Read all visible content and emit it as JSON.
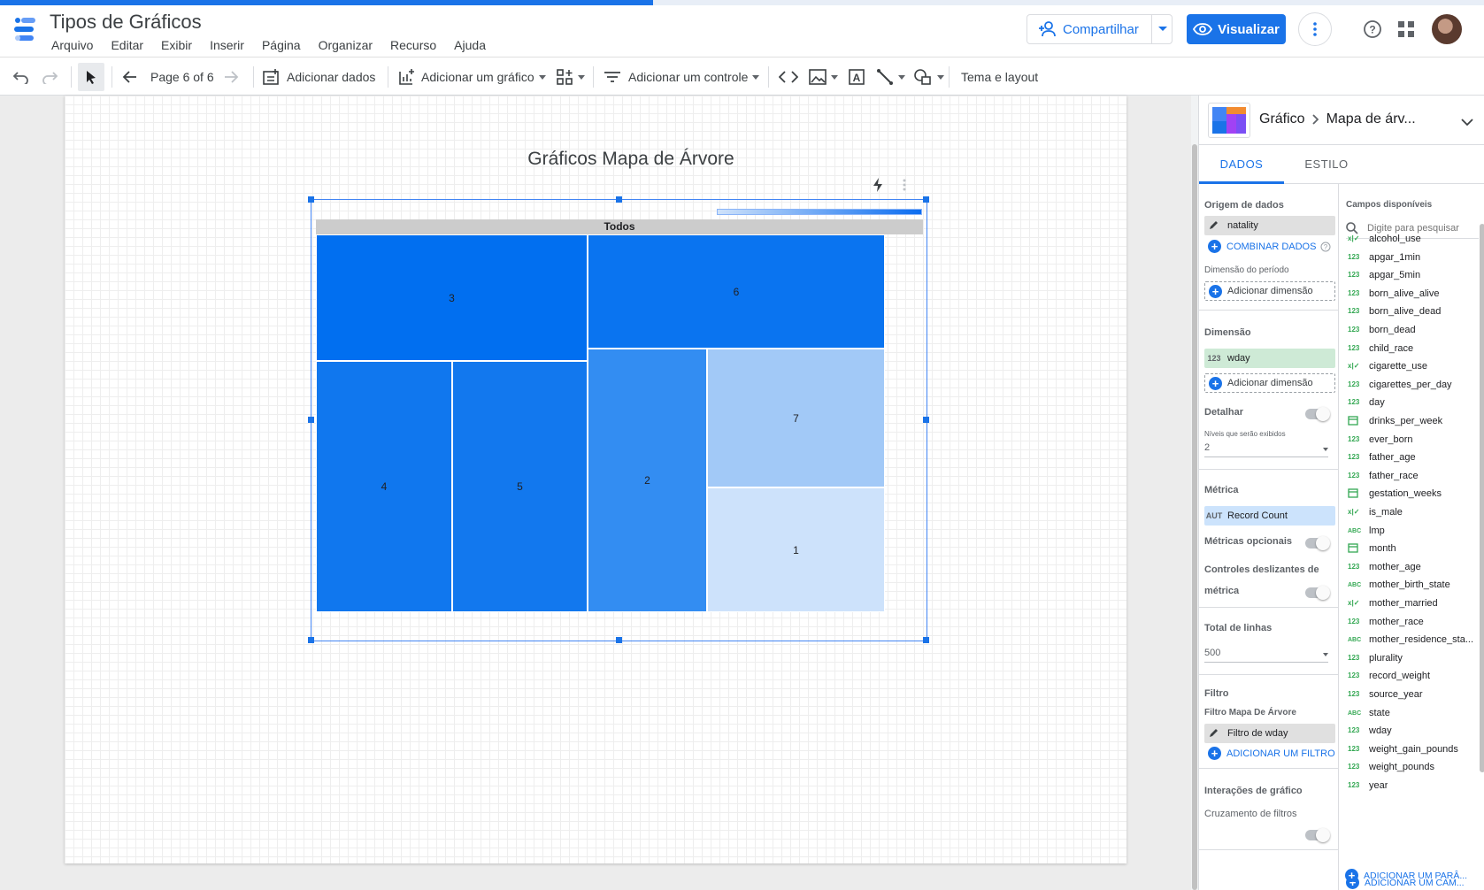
{
  "app": {
    "title": "Tipos de Gráficos",
    "menu": [
      "Arquivo",
      "Editar",
      "Exibir",
      "Inserir",
      "Página",
      "Organizar",
      "Recurso",
      "Ajuda"
    ],
    "share_label": "Compartilhar",
    "view_label": "Visualizar",
    "load_progress": 0.44
  },
  "toolbar": {
    "page_indicator": "Page 6 of 6",
    "add_data": "Adicionar dados",
    "add_chart": "Adicionar um gráfico",
    "add_control": "Adicionar um controle",
    "theme_layout": "Tema e layout"
  },
  "canvas": {
    "chart_title": "Gráficos Mapa de Árvore",
    "treemap_root": "Todos"
  },
  "chart_data": {
    "type": "treemap",
    "title": "Gráficos Mapa de Árvore",
    "root": "Todos",
    "dimension": "wday",
    "metric": "Record Count",
    "tiles": [
      {
        "label": "3",
        "color": "#016ff0"
      },
      {
        "label": "6",
        "color": "#0a74f0"
      },
      {
        "label": "4",
        "color": "#1077ee"
      },
      {
        "label": "5",
        "color": "#1278ee"
      },
      {
        "label": "2",
        "color": "#338df2"
      },
      {
        "label": "7",
        "color": "#a2c9f7"
      },
      {
        "label": "1",
        "color": "#cde2fb"
      }
    ],
    "color_scale": {
      "min_color": "#cfe2fa",
      "max_color": "#0a6cf0"
    }
  },
  "panel": {
    "breadcrumb_root": "Gráfico",
    "breadcrumb_current": "Mapa de árv...",
    "tabs": [
      "DADOS",
      "ESTILO"
    ],
    "data": {
      "source_label": "Origem de dados",
      "source_value": "natality",
      "blend_label": "COMBINAR DADOS",
      "period_dimension_label": "Dimensão do período",
      "add_dimension": "Adicionar dimensão",
      "dimension_label": "Dimensão",
      "dimension_type": "123",
      "dimension_value": "wday",
      "drilldown_label": "Detalhar",
      "levels_label": "Níveis que serão exibidos",
      "levels_value": "2",
      "metric_label": "Métrica",
      "metric_type": "AUT",
      "metric_value": "Record Count",
      "optional_metrics_label": "Métricas opcionais",
      "slider_label_1": "Controles deslizantes de",
      "slider_label_2": "métrica",
      "rows_label": "Total de linhas",
      "rows_value": "500",
      "filter_label": "Filtro",
      "filter_sub_label": "Filtro Mapa De Árvore",
      "filter_value": "Filtro de wday",
      "add_filter": "ADICIONAR UM FILTRO",
      "interactions_label": "Interações de gráfico",
      "cross_filter_label": "Cruzamento de filtros"
    },
    "fields": {
      "header": "Campos disponíveis",
      "search_placeholder": "Digite para pesquisar",
      "items": [
        {
          "type": "x|✓",
          "name": "alcohol_use"
        },
        {
          "type": "123",
          "name": "apgar_1min"
        },
        {
          "type": "123",
          "name": "apgar_5min"
        },
        {
          "type": "123",
          "name": "born_alive_alive"
        },
        {
          "type": "123",
          "name": "born_alive_dead"
        },
        {
          "type": "123",
          "name": "born_dead"
        },
        {
          "type": "123",
          "name": "child_race"
        },
        {
          "type": "x|✓",
          "name": "cigarette_use"
        },
        {
          "type": "123",
          "name": "cigarettes_per_day"
        },
        {
          "type": "123",
          "name": "day"
        },
        {
          "type": "cal",
          "name": "drinks_per_week"
        },
        {
          "type": "123",
          "name": "ever_born"
        },
        {
          "type": "123",
          "name": "father_age"
        },
        {
          "type": "123",
          "name": "father_race"
        },
        {
          "type": "cal",
          "name": "gestation_weeks"
        },
        {
          "type": "x|✓",
          "name": "is_male"
        },
        {
          "type": "ABC",
          "name": "lmp"
        },
        {
          "type": "cal",
          "name": "month"
        },
        {
          "type": "123",
          "name": "mother_age"
        },
        {
          "type": "ABC",
          "name": "mother_birth_state"
        },
        {
          "type": "x|✓",
          "name": "mother_married"
        },
        {
          "type": "123",
          "name": "mother_race"
        },
        {
          "type": "ABC",
          "name": "mother_residence_sta..."
        },
        {
          "type": "123",
          "name": "plurality"
        },
        {
          "type": "123",
          "name": "record_weight"
        },
        {
          "type": "123",
          "name": "source_year"
        },
        {
          "type": "ABC",
          "name": "state"
        },
        {
          "type": "123",
          "name": "wday"
        },
        {
          "type": "123",
          "name": "weight_gain_pounds"
        },
        {
          "type": "123",
          "name": "weight_pounds"
        },
        {
          "type": "123",
          "name": "year"
        }
      ],
      "add_field": "ADICIONAR UM CAM...",
      "add_param": "ADICIONAR UM PARÂ..."
    }
  }
}
